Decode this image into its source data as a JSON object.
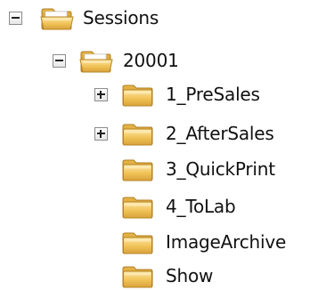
{
  "tree": {
    "root": {
      "label": "Sessions",
      "expanded": true,
      "icon": "folder-open-icon",
      "children": [
        {
          "label": "20001",
          "expanded": true,
          "icon": "folder-open-icon",
          "children": [
            {
              "label": "1_PreSales",
              "expanded": false,
              "has_children": true,
              "icon": "folder-icon"
            },
            {
              "label": "2_AfterSales",
              "expanded": false,
              "has_children": true,
              "icon": "folder-icon"
            },
            {
              "label": "3_QuickPrint",
              "has_children": false,
              "icon": "folder-icon"
            },
            {
              "label": "4_ToLab",
              "has_children": false,
              "icon": "folder-icon"
            },
            {
              "label": "ImageArchive",
              "has_children": false,
              "icon": "folder-icon"
            },
            {
              "label": "Show",
              "has_children": false,
              "icon": "folder-icon"
            }
          ]
        }
      ]
    }
  },
  "colors": {
    "folder_body": "#f2c55c",
    "folder_light": "#fbe3a0",
    "folder_dark": "#c8962e",
    "toggle_border": "#8c8c8c"
  }
}
